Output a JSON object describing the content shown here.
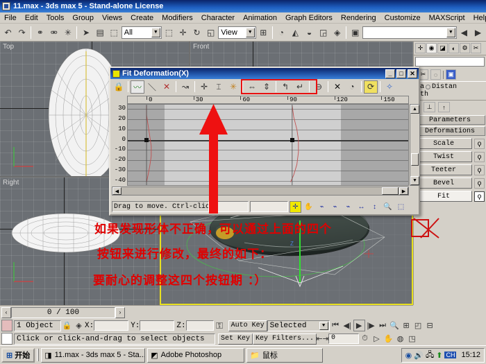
{
  "window": {
    "title": "11.max - 3ds max 5 - Stand-alone License",
    "minimize": "_",
    "maximize": "□",
    "close": "✕"
  },
  "menu": {
    "items": [
      "File",
      "Edit",
      "Tools",
      "Group",
      "Views",
      "Create",
      "Modifiers",
      "Character",
      "Animation",
      "Graph Editors",
      "Rendering",
      "Customize",
      "MAXScript",
      "Help"
    ]
  },
  "toolbar": {
    "undo_icon": "↶",
    "redo_icon": "↷",
    "select_link_icon": "⚭",
    "unlink_icon": "⚮",
    "bind_space_warp_icon": "✳",
    "select_object_icon": "➤",
    "select_by_name_icon": "▤",
    "select_region_icon": "⬚",
    "selection_filter": "All",
    "window_crossing_icon": "⬚",
    "select_move_icon": "✛",
    "select_rotate_icon": "↻",
    "select_scale_icon": "◱",
    "ref_coord_sys": "View",
    "use_center_icon": "⊞",
    "select_affect_icon": "◔",
    "mirror_icon": "◭",
    "align_icon": "◒",
    "curve_editor_icon": "◲",
    "layer_icon": "◈",
    "named_selection_icon": "▣",
    "named_sets": "",
    "prev_icon": "◀",
    "next_icon": "▶"
  },
  "viewports": [
    {
      "id": "top",
      "label": "Top"
    },
    {
      "id": "front",
      "label": "Front"
    },
    {
      "id": "right",
      "label": "Right"
    },
    {
      "id": "persp",
      "label": ""
    }
  ],
  "command_panel": {
    "tab_icons": [
      "✛",
      "◉",
      "◪",
      "◐",
      "⚙",
      "✂"
    ],
    "cut_icon": "✂",
    "refine_icon": "◌",
    "insert_icon": "▣",
    "radio_label_a": "ta",
    "radio_label_b": "Distan",
    "radio_label_c": "ath",
    "arrow_down_icon": "⊥",
    "arrow_up_icon": "↑",
    "parameters_rollout": "Parameters",
    "deformations_rollout": "Deformations",
    "deformations": [
      {
        "label": "Scale",
        "bulb": "ϙ",
        "active": false
      },
      {
        "label": "Twist",
        "bulb": "ϙ",
        "active": false
      },
      {
        "label": "Teeter",
        "bulb": "ϙ",
        "active": false
      },
      {
        "label": "Bevel",
        "bulb": "ϙ",
        "active": false
      },
      {
        "label": "Fit",
        "bulb": "ϙ",
        "active": true
      }
    ]
  },
  "time_slider": {
    "prev_icon": "‹",
    "next_icon": "›",
    "value": "0 / 100"
  },
  "status_bar": {
    "object_count": "1 Object",
    "lock_icon": "🔒",
    "coord_icon": "◈",
    "x_label": "X:",
    "y_label": "Y:",
    "z_label": "Z:",
    "x_value": "",
    "y_value": "",
    "z_value": "",
    "key_lock_icon": "⚿",
    "prompt": "Click or click-and-drag to select objects",
    "auto_key": "Auto Key",
    "set_key": "Set Key",
    "key_mode": "Selected",
    "key_filters": "Key Filters...",
    "frame_value": "0",
    "playback": {
      "go_start": "⏮",
      "prev_frame": "◀|",
      "play": "▶",
      "next_frame": "|▶",
      "go_end": "⏭",
      "key_mode_toggle": "⇤⇥",
      "time_config": "⏱"
    },
    "nav_icons": [
      "🔍",
      "⊞",
      "◰",
      "⊟",
      "▷",
      "✋",
      "◍",
      "◳"
    ]
  },
  "fit_dialog": {
    "title": "Fit Deformation(X)",
    "minimize": "_",
    "maximize": "□",
    "close": "✕",
    "toolbar": {
      "move_lock_icon": "🔒",
      "curve_move_icon": "〰",
      "curve_scale_icon": "＼",
      "delete_curve_icon": "✕",
      "reset_curve_icon": "↝",
      "move_control_icon": "✛",
      "scale_control_icon": "⌶",
      "insert_corner_icon": "✳",
      "mirror_horizontal_icon": "⇔",
      "mirror_vertical_icon": "⇕",
      "rotate_ccw_icon": "↰",
      "rotate_cw_icon": "↵",
      "get_shape_icon": "⊖",
      "delete_shape_icon": "✕",
      "generate_path_icon": "◔",
      "display_x_axis_icon": "⟳",
      "auto_symmetry_icon": "✧"
    },
    "highlight_note": "four transform buttons highlighted in red",
    "graph": {
      "x_ticks": [
        0,
        30,
        60,
        90,
        120,
        150
      ],
      "y_ticks": [
        30,
        20,
        10,
        0,
        -10,
        -20,
        -30,
        -40
      ],
      "control_points": [
        {
          "x": 0,
          "y": 0
        },
        {
          "x": 93,
          "y": 0
        }
      ]
    },
    "status": {
      "prompt": "Drag to move. Ctrl-clic",
      "field_1": "",
      "field_2": ""
    },
    "nav_icons": {
      "move_key_icon": "✛",
      "pan_icon": "✋",
      "zoom_extents_icon": "⌁",
      "zoom_horiz_extents_icon": "⌁",
      "zoom_value_extents_icon": "⌁",
      "zoom_horizontal_icon": "↔",
      "zoom_vertical_icon": "↕",
      "zoom_icon": "🔍",
      "zoom_region_icon": "⬚"
    }
  },
  "annotations": {
    "line1": "如果发现形体不正确，可以通过上面的四个",
    "line2": "按钮来进行修改，最终的如下：",
    "line3": "要耐心的调整这四个按钮期 ：）",
    "arrow_color": "#ee1111",
    "text_color": "#e00000"
  },
  "chart_data": {
    "type": "line",
    "title": "Fit Deformation(X)",
    "xlabel": "",
    "ylabel": "",
    "xlim": [
      -12,
      168
    ],
    "ylim": [
      -44,
      34
    ],
    "x_ticks": [
      0,
      30,
      60,
      90,
      120,
      150
    ],
    "y_ticks": [
      30,
      20,
      10,
      0,
      -10,
      -20,
      -30,
      -40
    ],
    "grid": true,
    "series": [
      {
        "name": "fit-curve-left",
        "color": "#c05050",
        "x": [
          0,
          0,
          1,
          2,
          3,
          3,
          2,
          1,
          0
        ],
        "y": [
          33,
          24,
          14,
          4,
          -6,
          -16,
          -26,
          -34,
          -41
        ]
      },
      {
        "name": "fit-curve-right",
        "color": "#c05050",
        "x": [
          93,
          94,
          96,
          97,
          97,
          96,
          94,
          92
        ],
        "y": [
          33,
          22,
          10,
          0,
          -12,
          -24,
          -34,
          -41
        ]
      },
      {
        "name": "baseline",
        "color": "#3a3a3a",
        "x": [
          0,
          93
        ],
        "y": [
          0,
          0
        ]
      }
    ],
    "control_points": [
      {
        "x": 0,
        "y": 0
      },
      {
        "x": 93,
        "y": 0
      }
    ]
  },
  "taskbar": {
    "start": "开始",
    "start_icon": "⊞",
    "tasks": [
      {
        "label": "11.max - 3ds max 5 - Sta...",
        "icon": "◨"
      },
      {
        "label": "Adobe Photoshop",
        "icon": "◩"
      },
      {
        "label": "鼠标",
        "icon": "📁"
      }
    ],
    "tray_icons": [
      "◉",
      "🔊",
      "🖧",
      "⬆",
      "CH"
    ],
    "clock": "15:12"
  }
}
